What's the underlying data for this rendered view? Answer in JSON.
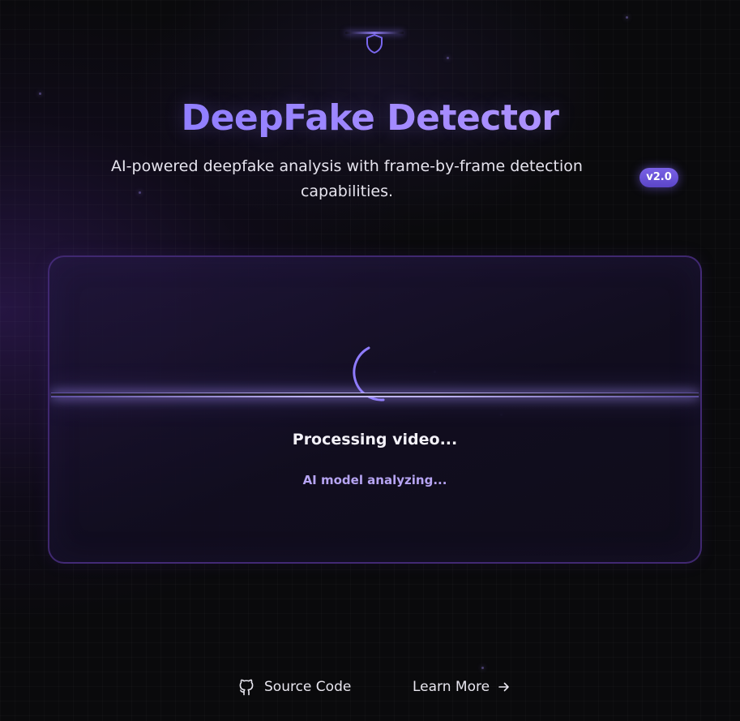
{
  "app": {
    "title": "DeepFake Detector",
    "subtitle": "AI-powered deepfake analysis with frame-by-frame detection capabilities.",
    "version": "v2.0"
  },
  "processing": {
    "status": "Processing video...",
    "detail": "AI model analyzing..."
  },
  "footer": {
    "source_code": "Source Code",
    "learn_more": "Learn More"
  },
  "icons": {
    "logo": "shield-icon",
    "spinner": "loading-spinner-icon",
    "source": "github-icon",
    "learn": "arrow-right-icon"
  },
  "colors": {
    "accent": "#8b78ff",
    "accent_light": "#b6a4f2",
    "background": "#0a0a0c",
    "card_border": "#50328c",
    "badge": "#6a52d8"
  }
}
